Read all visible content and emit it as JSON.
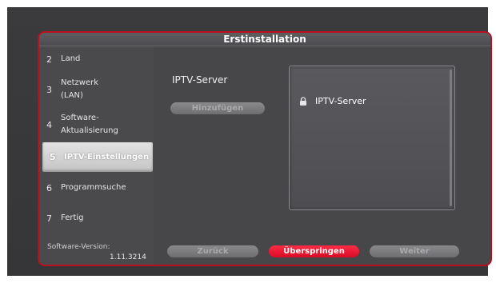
{
  "dialog": {
    "title": "Erstinstallation"
  },
  "sidebar": {
    "items": [
      {
        "number": "2",
        "label": "Land"
      },
      {
        "number": "3",
        "label": "Netzwerk\n(LAN)"
      },
      {
        "number": "4",
        "label": "Software-\nAktualisierung"
      },
      {
        "number": "5",
        "label": "IPTV-Einstellungen"
      },
      {
        "number": "6",
        "label": "Programmsuche"
      },
      {
        "number": "7",
        "label": "Fertig"
      }
    ],
    "version_label": "Software-Version:",
    "version_value": "1.11.3214"
  },
  "main": {
    "heading": "IPTV-Server",
    "add_button": "Hinzufügen",
    "server_list": [
      {
        "label": "IPTV-Server",
        "icon": "lock-icon"
      }
    ]
  },
  "footer": {
    "back_button": "Zurück",
    "skip_button": "Überspringen",
    "next_button": "Weiter"
  },
  "colors": {
    "accent": "#e0102a",
    "dialog_border": "#b8101c",
    "background": "#47474a"
  }
}
